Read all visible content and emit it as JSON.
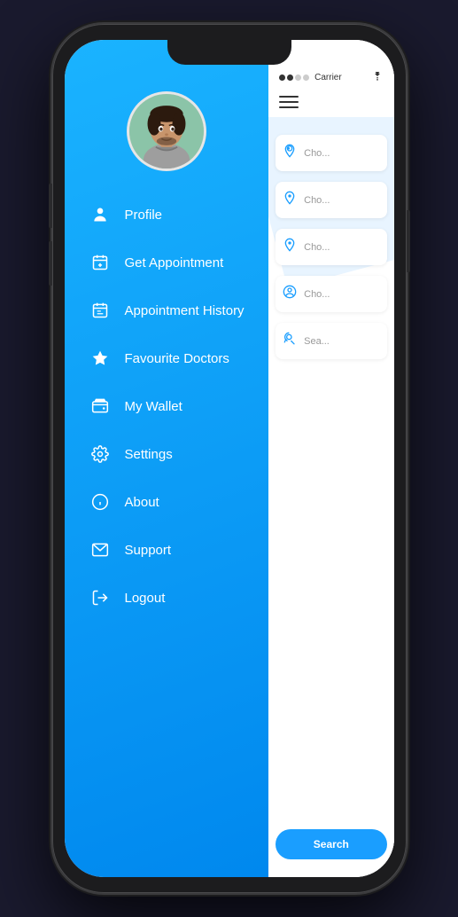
{
  "phone": {
    "status_bar": {
      "signal_dots": 2,
      "carrier": "Carrier",
      "wifi": "⌂"
    },
    "sidebar": {
      "menu_items": [
        {
          "id": "profile",
          "icon": "👤",
          "icon_name": "person-icon",
          "label": "Profile"
        },
        {
          "id": "get-appointment",
          "icon": "📅",
          "icon_name": "calendar-plus-icon",
          "label": "Get Appointment"
        },
        {
          "id": "appointment-history",
          "icon": "📆",
          "icon_name": "calendar-history-icon",
          "label": "Appointment History"
        },
        {
          "id": "favourite-doctors",
          "icon": "⭐",
          "icon_name": "star-icon",
          "label": "Favourite Doctors"
        },
        {
          "id": "my-wallet",
          "icon": "💳",
          "icon_name": "wallet-icon",
          "label": "My Wallet"
        },
        {
          "id": "settings",
          "icon": "⚙️",
          "icon_name": "gear-icon",
          "label": "Settings"
        },
        {
          "id": "about",
          "icon": "ℹ️",
          "icon_name": "info-icon",
          "label": "About"
        },
        {
          "id": "support",
          "icon": "✉️",
          "icon_name": "envelope-icon",
          "label": "Support"
        },
        {
          "id": "logout",
          "icon": "🚪",
          "icon_name": "logout-icon",
          "label": "Logout"
        }
      ]
    },
    "right_panel": {
      "cards": [
        {
          "icon": "📍",
          "icon_name": "location-icon",
          "text": "Cho..."
        },
        {
          "icon": "📍",
          "icon_name": "location-icon",
          "text": "Cho..."
        },
        {
          "icon": "📍",
          "icon_name": "location-icon",
          "text": "Cho..."
        },
        {
          "icon": "👤",
          "icon_name": "person-circle-icon",
          "text": "Cho..."
        },
        {
          "icon": "🔍",
          "icon_name": "search-person-icon",
          "text": "Sea..."
        }
      ],
      "search_button_label": "Search"
    }
  }
}
